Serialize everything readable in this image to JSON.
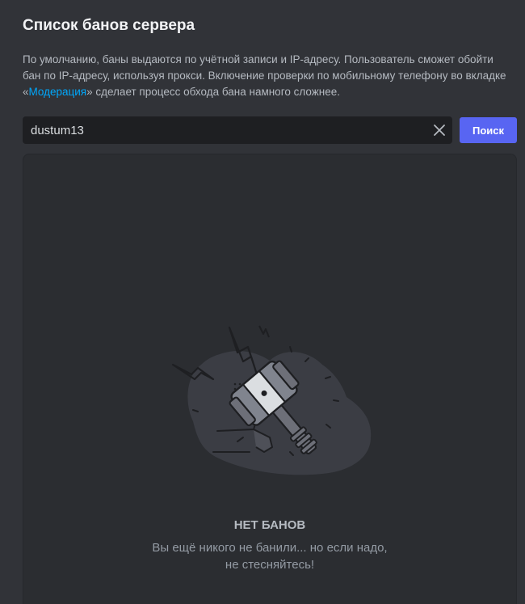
{
  "header": {
    "title": "Список банов сервера"
  },
  "description": {
    "text_before": "По умолчанию, баны выдаются по учётной записи и IP-адресу. Пользователь сможет обойти бан по IP-адресу, используя прокси. Включение проверки по мобильному телефону во вкладке «",
    "link": "Модерация",
    "text_after": "» сделает процесс обхода бана намного сложнее."
  },
  "search": {
    "value": "dustum13",
    "button_label": "Поиск",
    "clear_icon": "close-icon"
  },
  "empty_state": {
    "title": "НЕТ БАНОВ",
    "line1": "Вы ещё никого не банили... но если надо,",
    "line2": "не стесняйтесь!",
    "illustration": "ban-hammer-illustration"
  },
  "colors": {
    "background": "#313338",
    "panel": "#2b2d31",
    "input": "#1e1f22",
    "accent": "#5865f2",
    "link": "#00a8fc"
  }
}
